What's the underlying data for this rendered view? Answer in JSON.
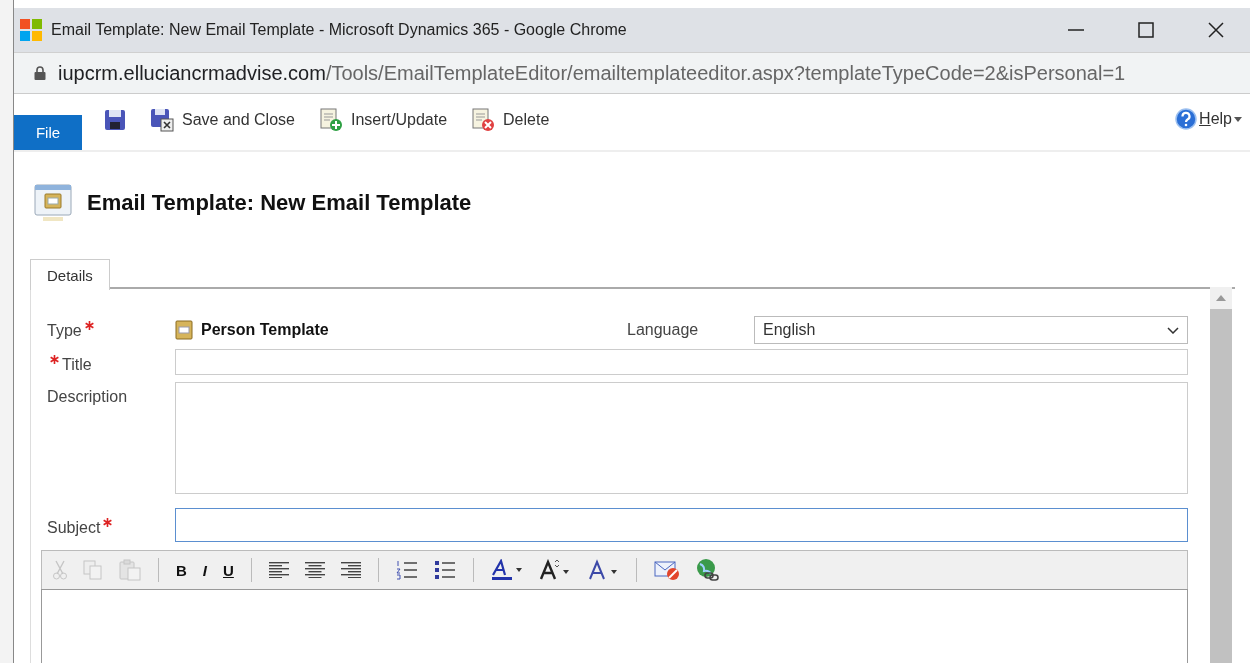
{
  "window": {
    "title": "Email Template: New Email Template - Microsoft Dynamics 365 - Google Chrome"
  },
  "address_bar": {
    "host": "iupcrm.elluciancrmadvise.com",
    "path": "/Tools/EmailTemplateEditor/emailtemplateeditor.aspx?templateTypeCode=2&isPersonal=1"
  },
  "ribbon": {
    "file_tab": "File",
    "commands": [
      {
        "kind": "save"
      },
      {
        "kind": "save-close",
        "label": "Save and Close"
      },
      {
        "kind": "insert",
        "label": "Insert/Update"
      },
      {
        "kind": "delete",
        "label": "Delete"
      }
    ],
    "help": "Help"
  },
  "header": {
    "title": "Email Template: New Email Template"
  },
  "tabs": [
    {
      "label": "Details",
      "selected": true
    }
  ],
  "form": {
    "type_label": "Type",
    "type_required": true,
    "type_value": "Person Template",
    "language_label": "Language",
    "language_value": "English",
    "title_label": "Title",
    "title_required": true,
    "description_label": "Description",
    "subject_label": "Subject",
    "subject_required": true
  },
  "editor_toolbar": [
    {
      "kind": "cut",
      "disabled": true
    },
    {
      "kind": "copy",
      "disabled": true
    },
    {
      "kind": "paste",
      "disabled": true
    },
    {
      "kind": "sep"
    },
    {
      "kind": "bold",
      "text": "B",
      "disabled": false
    },
    {
      "kind": "italic",
      "text": "I",
      "disabled": false
    },
    {
      "kind": "underline",
      "text": "U",
      "disabled": false
    },
    {
      "kind": "sep"
    },
    {
      "kind": "align-left",
      "disabled": false
    },
    {
      "kind": "align-center",
      "disabled": false
    },
    {
      "kind": "align-right",
      "disabled": false
    },
    {
      "kind": "sep"
    },
    {
      "kind": "numbered-list",
      "disabled": false
    },
    {
      "kind": "bulleted-list",
      "disabled": false
    },
    {
      "kind": "sep"
    },
    {
      "kind": "highlight",
      "disabled": false
    },
    {
      "kind": "font-size",
      "disabled": false
    },
    {
      "kind": "font-color",
      "disabled": false
    },
    {
      "kind": "sep"
    },
    {
      "kind": "unsubscribe",
      "disabled": false
    },
    {
      "kind": "link",
      "disabled": false
    }
  ]
}
